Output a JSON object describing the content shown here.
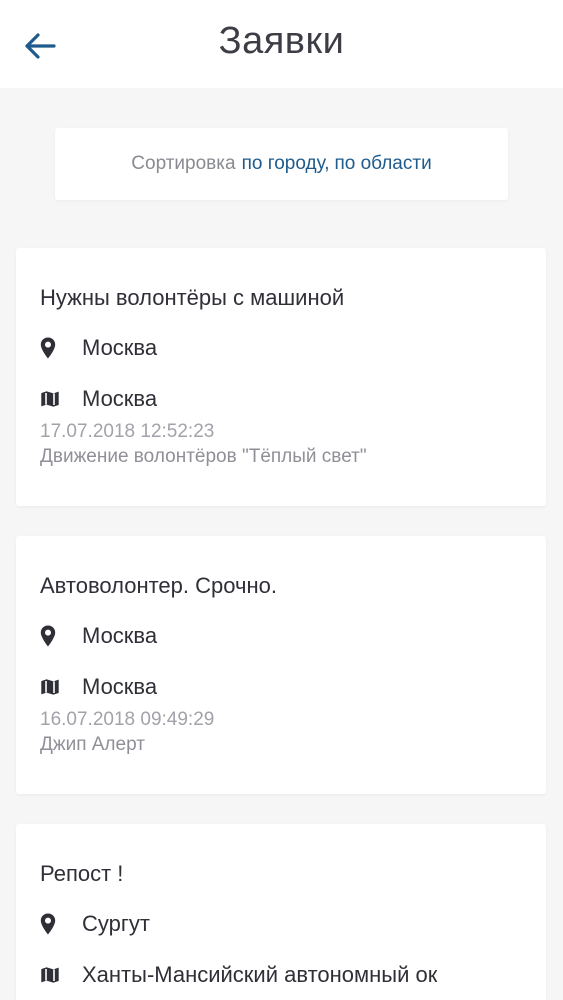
{
  "header": {
    "title": "Заявки",
    "back_icon": "arrow-left-icon",
    "accent": "#1f5b8c"
  },
  "sort": {
    "label": "Сортировка",
    "by_city": "по городу,",
    "by_region": "по области"
  },
  "requests": [
    {
      "title": "Нужны волонтёры с машиной",
      "city": "Москва",
      "region": "Москва",
      "date": "17.07.2018 12:52:23",
      "author": "Движение волонтёров \"Тёплый свет\""
    },
    {
      "title": "Автоволонтер. Срочно.",
      "city": "Москва",
      "region": "Москва",
      "date": "16.07.2018 09:49:29",
      "author": "Джип Алерт"
    },
    {
      "title": "Репост !",
      "city": "Сургут",
      "region": "Ханты-Мансийский автономный ок"
    }
  ]
}
